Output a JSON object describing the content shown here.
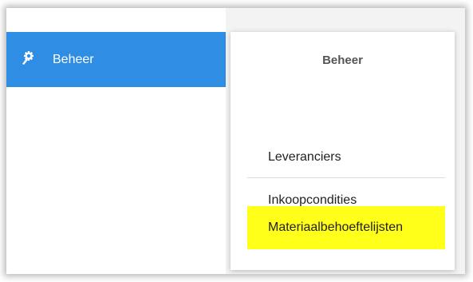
{
  "nav": {
    "item_label": "Beheer",
    "item_icon": "wrench-gear-icon",
    "active_color": "#2f8de4"
  },
  "popup": {
    "title": "Beheer",
    "items": [
      {
        "label": "Leveranciers"
      },
      {
        "label": "Inkoopcondities"
      },
      {
        "label": "Materiaalbehoeftelijsten",
        "highlighted": true
      }
    ],
    "highlight_color": "#ffff1a"
  }
}
